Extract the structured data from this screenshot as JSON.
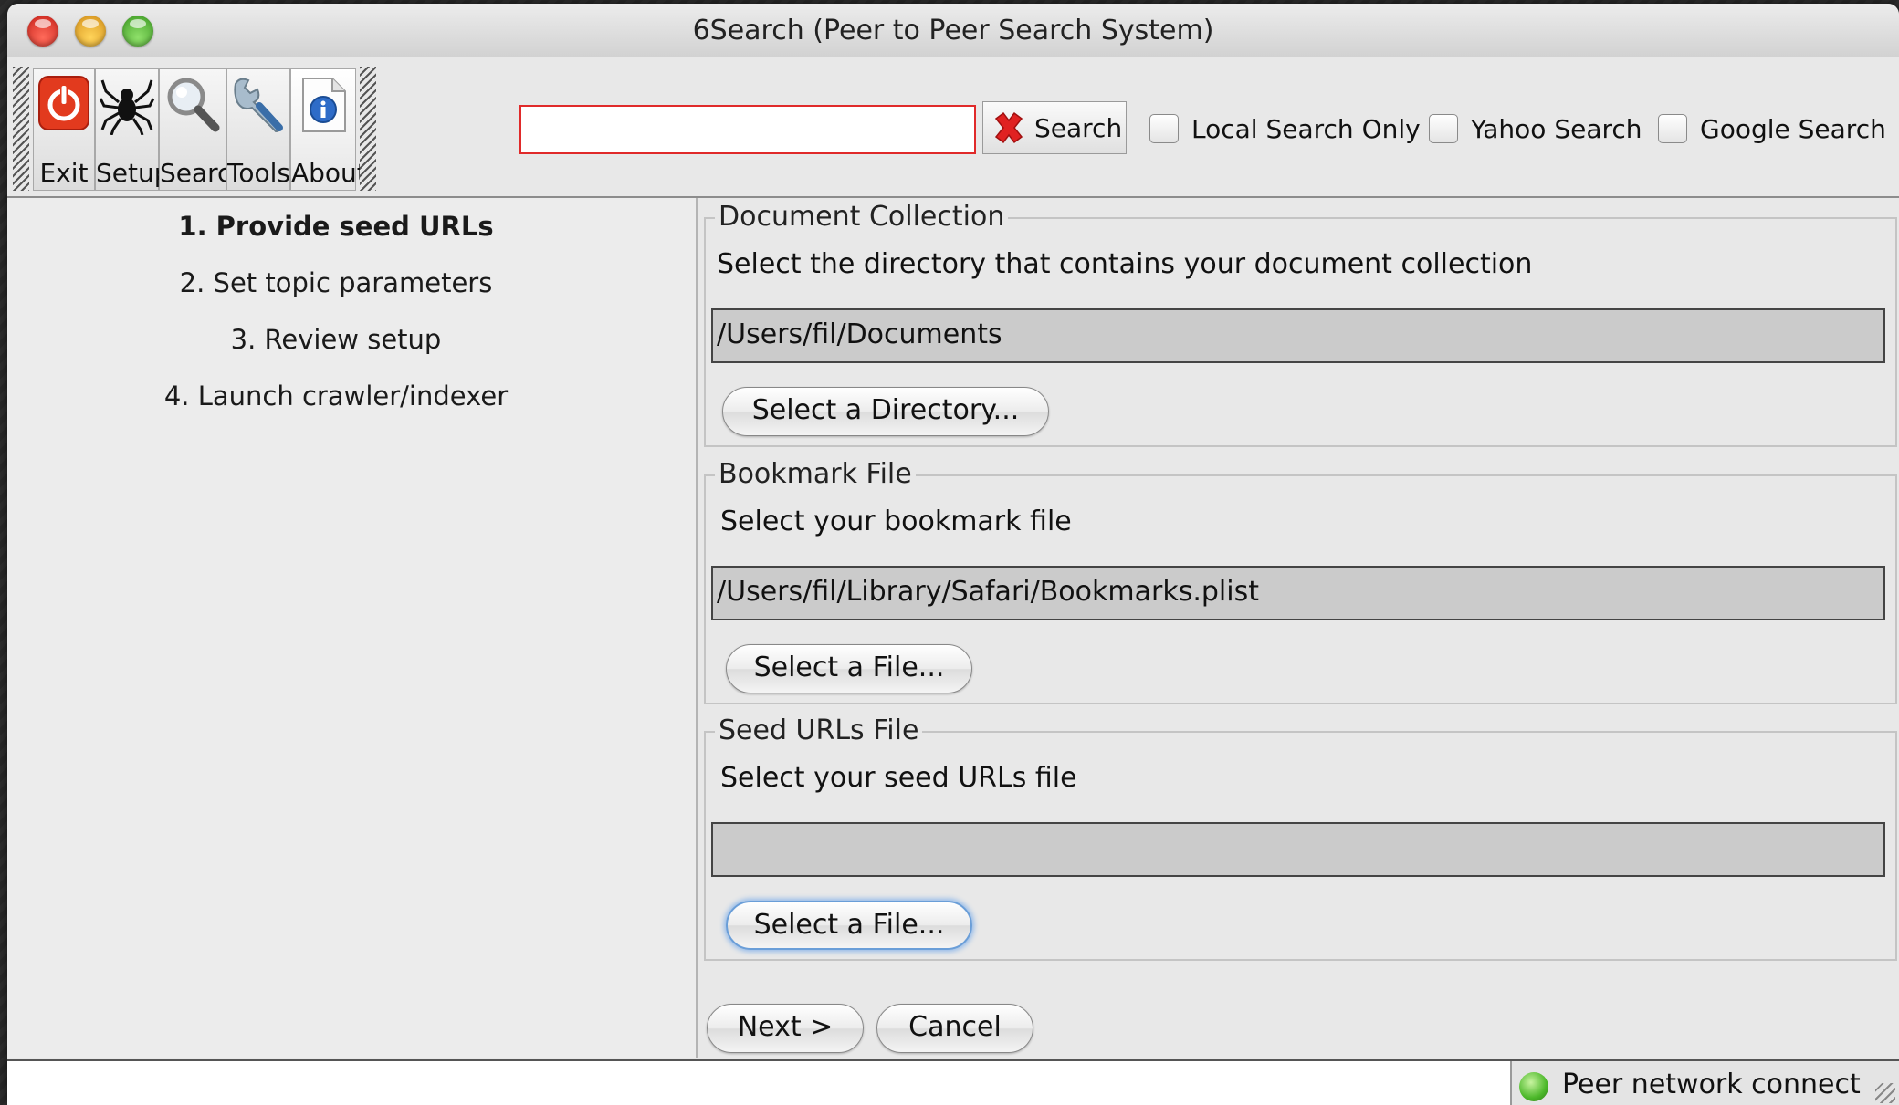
{
  "window": {
    "title": "6Search (Peer to Peer Search System)"
  },
  "toolbar": {
    "buttons": [
      {
        "label": "Exit",
        "icon": "power-icon"
      },
      {
        "label": "Setup",
        "icon": "spider-icon"
      },
      {
        "label": "Search",
        "icon": "magnifier-icon"
      },
      {
        "label": "Tools",
        "icon": "wrench-icon"
      },
      {
        "label": "About",
        "icon": "info-document-icon"
      }
    ],
    "search_value": "",
    "search_button": "Search",
    "checkboxes": [
      {
        "label": "Local Search Only",
        "checked": false
      },
      {
        "label": "Yahoo Search",
        "checked": false
      },
      {
        "label": "Google Search",
        "checked": false
      }
    ]
  },
  "steps": [
    {
      "label": "1. Provide seed URLs",
      "active": true
    },
    {
      "label": "2. Set topic parameters",
      "active": false
    },
    {
      "label": "3. Review setup",
      "active": false
    },
    {
      "label": "4. Launch crawler/indexer",
      "active": false
    }
  ],
  "groups": {
    "document_collection": {
      "legend": "Document Collection",
      "description": "Select the directory that contains your document collection",
      "path": "/Users/fil/Documents",
      "button": "Select a Directory..."
    },
    "bookmark_file": {
      "legend": "Bookmark File",
      "description": "Select your bookmark file",
      "path": "/Users/fil/Library/Safari/Bookmarks.plist",
      "button": "Select a File..."
    },
    "seed_urls_file": {
      "legend": "Seed URLs File",
      "description": "Select your seed URLs file",
      "path": "",
      "button": "Select a File..."
    }
  },
  "nav": {
    "next": "Next >",
    "cancel": "Cancel"
  },
  "status": {
    "text": "Peer network connect",
    "indicator_color": "#4cb82a"
  },
  "colors": {
    "search_field_border": "#e02a2a",
    "focus_ring": "#6a9ed8"
  }
}
